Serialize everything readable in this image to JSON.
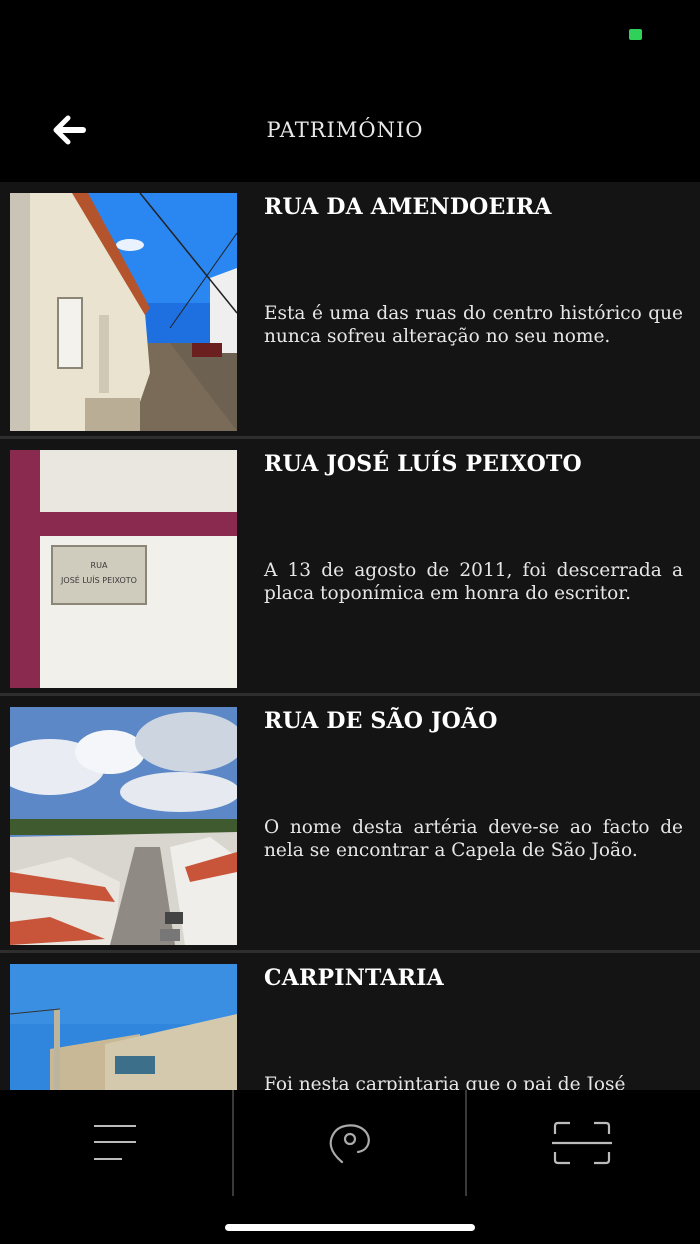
{
  "status_bar": {
    "indicator_color": "#2fd158"
  },
  "header": {
    "title": "PATRIMÓNIO",
    "back_icon": "arrow-left-icon"
  },
  "items": [
    {
      "title": "RUA DA AMENDOEIRA",
      "description": "Esta é uma das ruas do centro histórico que nunca sofreu alteração no seu nome."
    },
    {
      "title": "RUA JOSÉ LUÍS PEIXOTO",
      "description": "A 13 de agosto de 2011, foi descerrada a placa toponímica em honra do escritor.",
      "plaque_line1": "RUA",
      "plaque_line2": "JOSÉ LUÍS PEIXOTO"
    },
    {
      "title": "RUA DE SÃO JOÃO",
      "description": "O nome desta artéria deve-se ao facto de nela se encontrar a Capela de São João."
    },
    {
      "title": "CARPINTARIA",
      "description": "Foi nesta carpintaria que o pai de José"
    }
  ],
  "tabbar": {
    "tabs": [
      {
        "icon": "menu-icon"
      },
      {
        "icon": "map-pin-icon"
      },
      {
        "icon": "scan-icon"
      }
    ]
  }
}
